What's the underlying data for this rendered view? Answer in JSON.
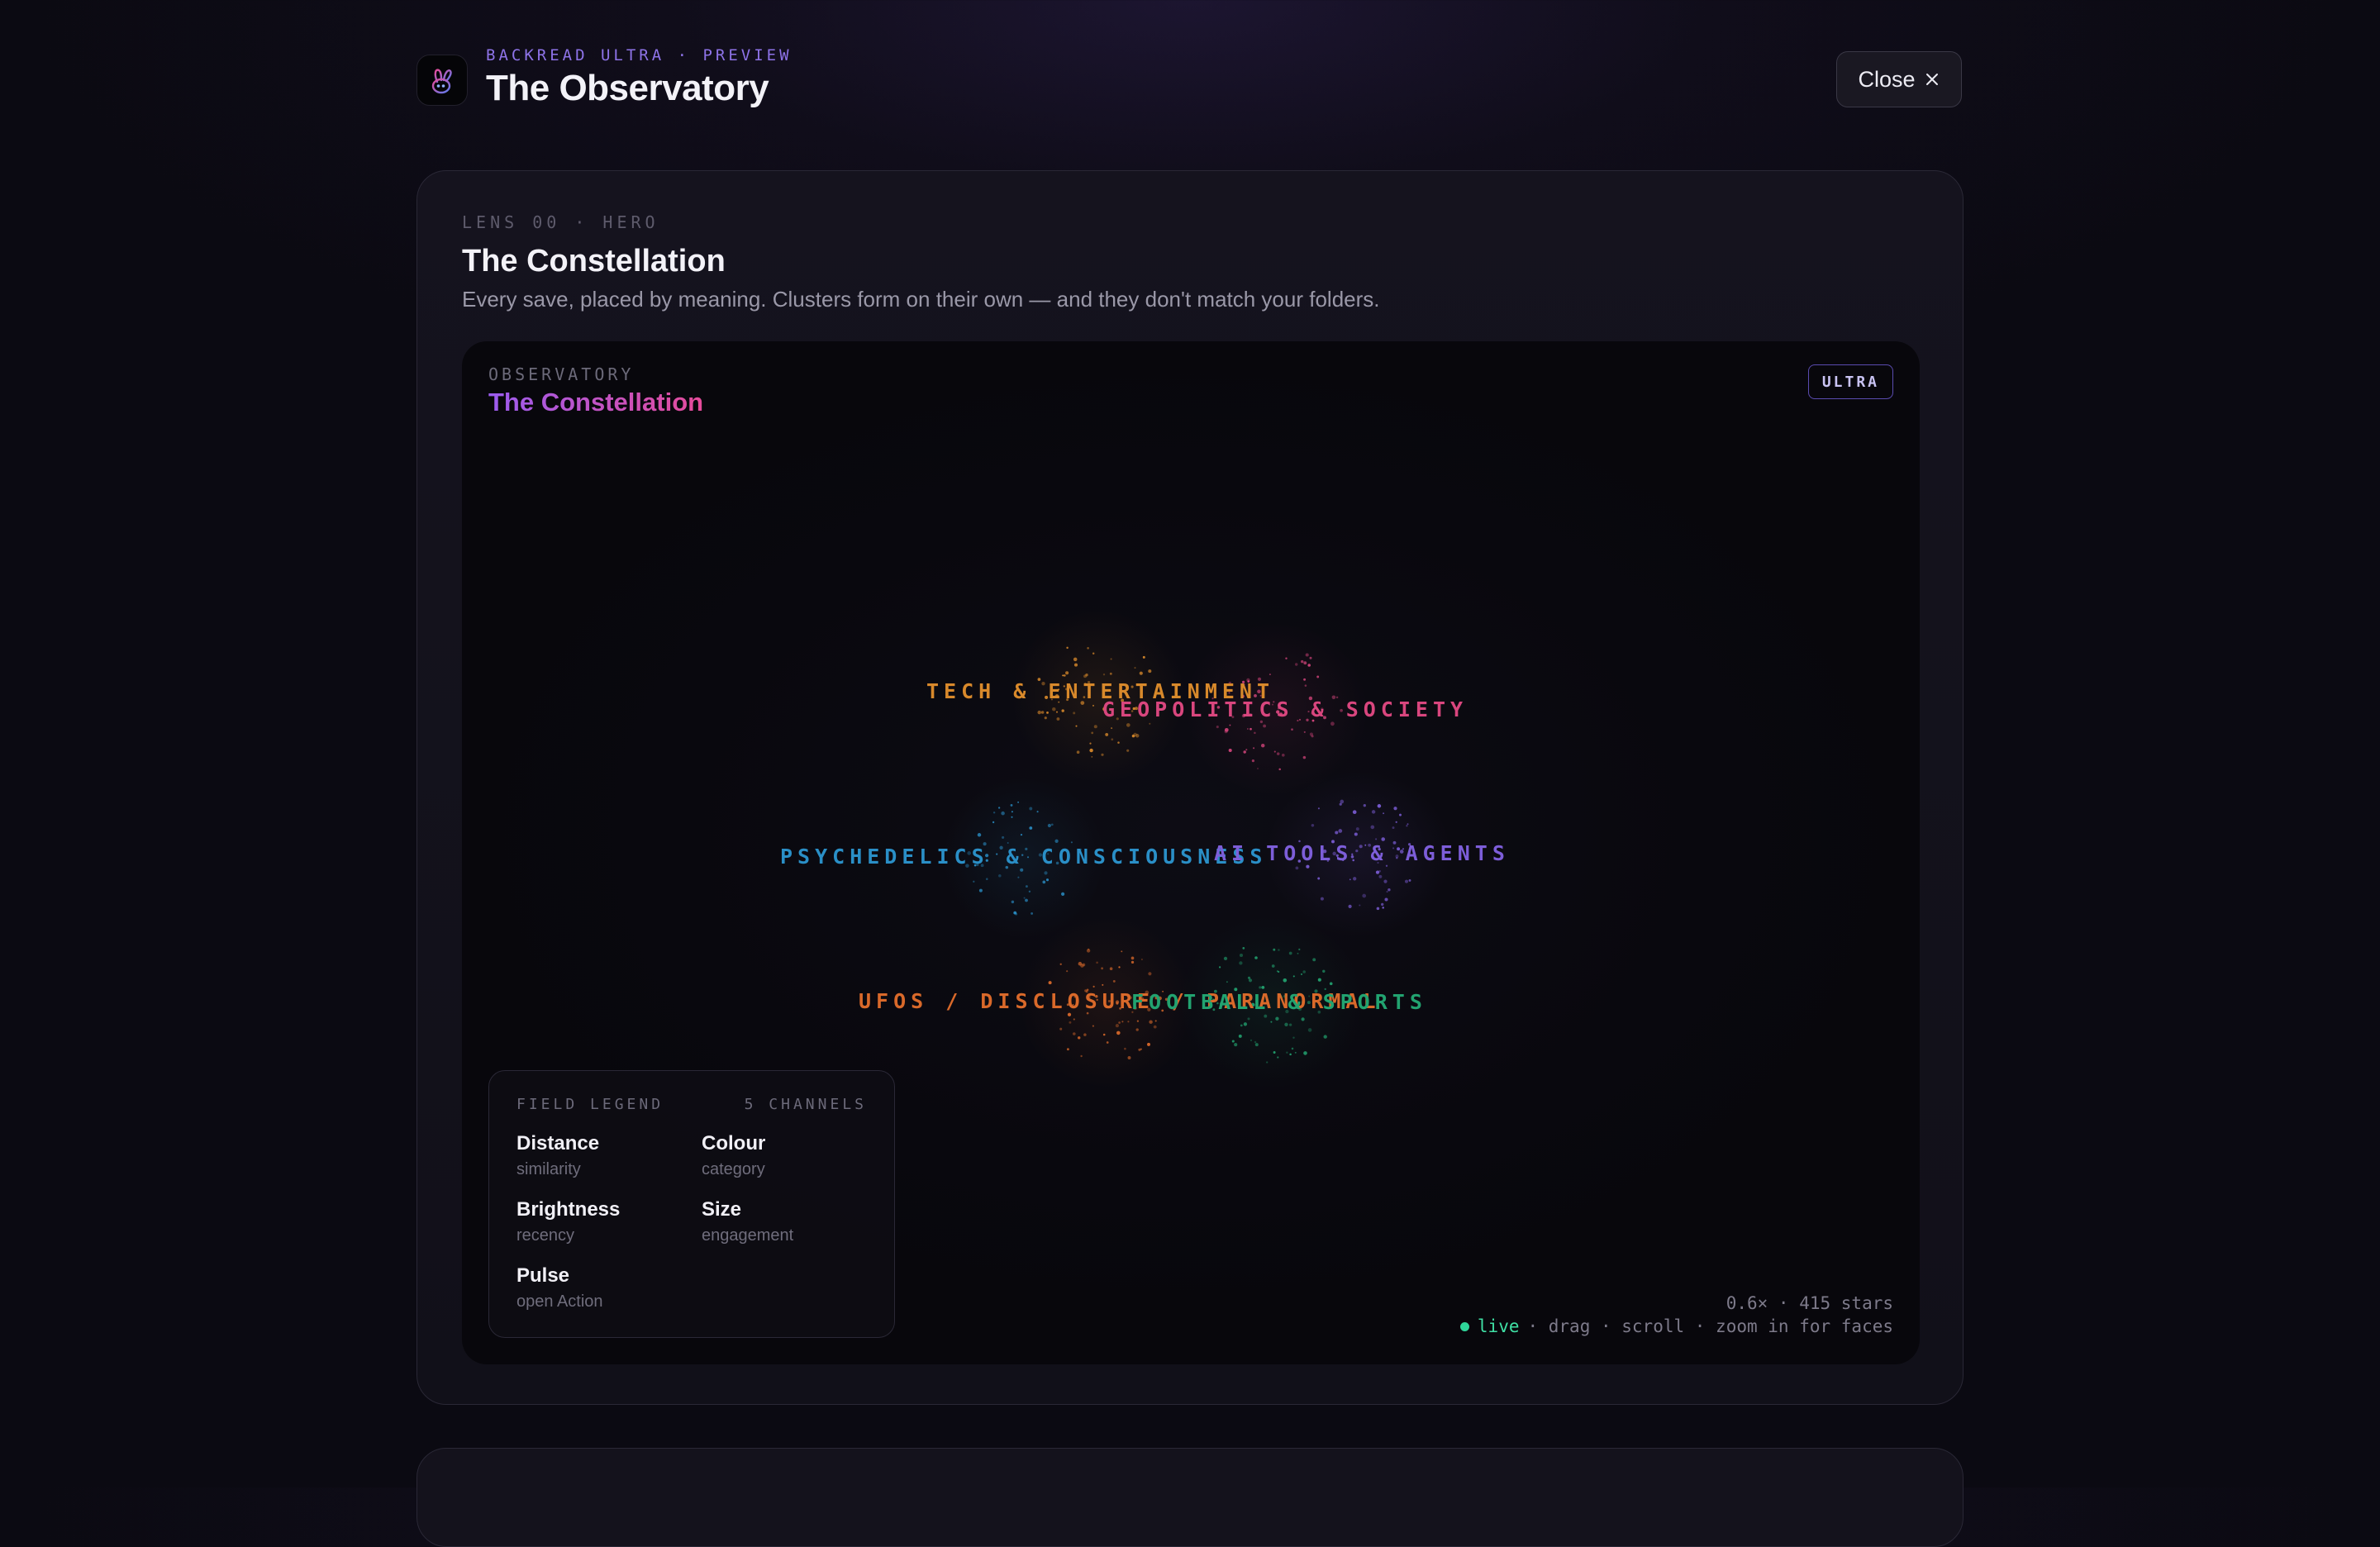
{
  "header": {
    "eyebrow": "BACKREAD ULTRA · PREVIEW",
    "title": "The Observatory",
    "close_label": "Close",
    "icon": "bunny-logo-icon"
  },
  "lens": {
    "kicker": "LENS 00 · HERO",
    "title": "The Constellation",
    "description": "Every save, placed by meaning. Clusters form on their own — and they don't match your folders."
  },
  "observatory": {
    "kicker": "OBSERVATORY",
    "title": "The Constellation",
    "badge": "ULTRA"
  },
  "clusters": [
    {
      "name": "TECH & ENTERTAINMENT",
      "color": "#d8892b"
    },
    {
      "name": "GEOPOLITICS & SOCIETY",
      "color": "#d9467e"
    },
    {
      "name": "PSYCHEDELICS & CONSCIOUSNESS",
      "color": "#2a8fc7"
    },
    {
      "name": "AI TOOLS & AGENTS",
      "color": "#7d5ed9"
    },
    {
      "name": "UFOS / DISCLOSURE / PARANORMAL",
      "color": "#d9692a"
    },
    {
      "name": "FOOTBALL & SPORTS",
      "color": "#22a370"
    }
  ],
  "legend": {
    "title": "FIELD LEGEND",
    "count": "5 CHANNELS",
    "items": [
      {
        "name": "Distance",
        "desc": "similarity"
      },
      {
        "name": "Colour",
        "desc": "category"
      },
      {
        "name": "Brightness",
        "desc": "recency"
      },
      {
        "name": "Size",
        "desc": "engagement"
      },
      {
        "name": "Pulse",
        "desc": "open Action"
      }
    ]
  },
  "footer": {
    "zoom_stats": "0.6× · 415 stars",
    "live": "live",
    "hint": "· drag · scroll · zoom in for faces"
  }
}
